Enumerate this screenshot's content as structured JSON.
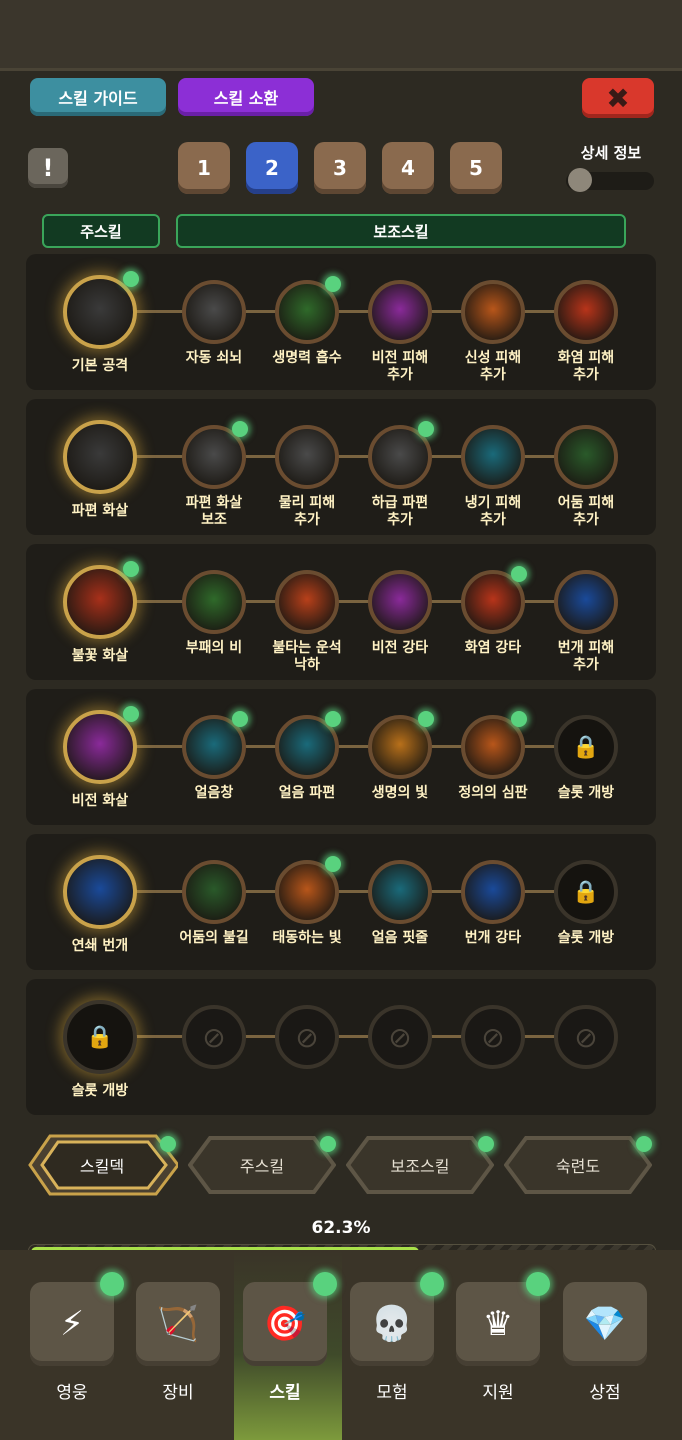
{
  "header": {
    "guide_label": "스킬 가이드",
    "summon_label": "스킬 소환",
    "close_glyph": "✖",
    "info_glyph": "!",
    "presets": [
      "1",
      "2",
      "3",
      "4",
      "5"
    ],
    "active_preset": "2",
    "detail_label": "상세 정보",
    "detail_toggle_on": false
  },
  "sections": {
    "main_label": "주스킬",
    "sub_label": "보조스킬"
  },
  "rows": [
    {
      "main": {
        "label": "기본 공격",
        "icon": "arrow-icon",
        "color": "#3a3a3a",
        "badge": true
      },
      "subs": [
        {
          "label": "자동 쇠뇌",
          "icon": "crossbow-icon",
          "color": "#4a4a4a",
          "badge": false
        },
        {
          "label": "생명력 흡수",
          "icon": "heart-icon",
          "color": "#2f6a2a",
          "badge": true
        },
        {
          "label": "비전 피해\n추가",
          "icon": "arcane-icon",
          "color": "#8a2a9a",
          "badge": false
        },
        {
          "label": "신성 피해\n추가",
          "icon": "holy-icon",
          "color": "#b8561a",
          "badge": false
        },
        {
          "label": "화염 피해\n추가",
          "icon": "fire-icon",
          "color": "#b8341a",
          "badge": false
        }
      ]
    },
    {
      "main": {
        "label": "파편 화살",
        "icon": "shard-arrow-icon",
        "color": "#3a3a3a",
        "badge": false
      },
      "subs": [
        {
          "label": "파편 화살\n보조",
          "icon": "shard-burst-icon",
          "color": "#4a4a4a",
          "badge": true
        },
        {
          "label": "물리 피해\n추가",
          "icon": "physical-icon",
          "color": "#4a4a4a",
          "badge": false
        },
        {
          "label": "하급 파편\n추가",
          "icon": "minor-shard-icon",
          "color": "#4a4a4a",
          "badge": true
        },
        {
          "label": "냉기 피해\n추가",
          "icon": "frost-icon",
          "color": "#1a6a7a",
          "badge": false
        },
        {
          "label": "어둠 피해\n추가",
          "icon": "skull-icon",
          "color": "#2a5a2a",
          "badge": false
        }
      ]
    },
    {
      "main": {
        "label": "불꽃 화살",
        "icon": "flame-arrow-icon",
        "color": "#a8301a",
        "badge": true
      },
      "subs": [
        {
          "label": "부패의 비",
          "icon": "decay-icon",
          "color": "#2f6a2a",
          "badge": false
        },
        {
          "label": "불타는 운석\n낙하",
          "icon": "meteor-icon",
          "color": "#b8401a",
          "badge": false
        },
        {
          "label": "비전 강타",
          "icon": "arcane-strike-icon",
          "color": "#8a2a9a",
          "badge": false
        },
        {
          "label": "화염 강타",
          "icon": "fire-strike-icon",
          "color": "#b8341a",
          "badge": true
        },
        {
          "label": "번개 피해\n추가",
          "icon": "lightning-icon",
          "color": "#1a4a9a",
          "badge": false
        }
      ]
    },
    {
      "main": {
        "label": "비전 화살",
        "icon": "arcane-arrow-icon",
        "color": "#8a2a9a",
        "badge": true
      },
      "subs": [
        {
          "label": "얼음창",
          "icon": "ice-spear-icon",
          "color": "#1a6a7a",
          "badge": true
        },
        {
          "label": "얼음 파편",
          "icon": "ice-shard-icon",
          "color": "#1a6a7a",
          "badge": true
        },
        {
          "label": "생명의 빛",
          "icon": "life-light-icon",
          "color": "#b8701a",
          "badge": true
        },
        {
          "label": "정의의 심판",
          "icon": "judgement-icon",
          "color": "#b8561a",
          "badge": true
        },
        {
          "label": "슬롯 개방",
          "icon": "lock-icon",
          "color": "#15130f",
          "badge": false,
          "locked": true
        }
      ]
    },
    {
      "main": {
        "label": "연쇄 번개",
        "icon": "chain-lightning-icon",
        "color": "#1a4a9a",
        "badge": false
      },
      "subs": [
        {
          "label": "어둠의 불길",
          "icon": "dark-flame-icon",
          "color": "#2a5a2a",
          "badge": false
        },
        {
          "label": "태동하는 빛",
          "icon": "pulse-light-icon",
          "color": "#b8561a",
          "badge": true
        },
        {
          "label": "얼음 핏줄",
          "icon": "ice-vein-icon",
          "color": "#1a6a7a",
          "badge": false
        },
        {
          "label": "번개 강타",
          "icon": "lightning-strike-icon",
          "color": "#1a4a9a",
          "badge": false
        },
        {
          "label": "슬롯 개방",
          "icon": "lock-icon",
          "color": "#15130f",
          "badge": false,
          "locked": true
        }
      ]
    },
    {
      "main": {
        "label": "슬롯 개방",
        "icon": "lock-icon",
        "color": "#15130f",
        "badge": false,
        "locked": true
      },
      "subs": [
        {
          "label": "",
          "icon": "blocked-icon",
          "empty": true
        },
        {
          "label": "",
          "icon": "blocked-icon",
          "empty": true
        },
        {
          "label": "",
          "icon": "blocked-icon",
          "empty": true
        },
        {
          "label": "",
          "icon": "blocked-icon",
          "empty": true
        },
        {
          "label": "",
          "icon": "blocked-icon",
          "empty": true
        }
      ]
    }
  ],
  "tabs": [
    {
      "label": "스킬덱",
      "active": true,
      "badge": true
    },
    {
      "label": "주스킬",
      "active": false,
      "badge": true
    },
    {
      "label": "보조스킬",
      "active": false,
      "badge": true
    },
    {
      "label": "숙련도",
      "active": false,
      "badge": true
    }
  ],
  "progress": {
    "text": "62.3%",
    "value": 0.623
  },
  "nav": [
    {
      "label": "영웅",
      "icon": "lightning-icon",
      "glyph": "⚡",
      "badge": true
    },
    {
      "label": "장비",
      "icon": "bow-icon",
      "glyph": "🏹",
      "badge": false
    },
    {
      "label": "스킬",
      "icon": "target-icon",
      "glyph": "🎯",
      "badge": true,
      "active": true
    },
    {
      "label": "모험",
      "icon": "skull-icon",
      "glyph": "💀",
      "badge": true
    },
    {
      "label": "지원",
      "icon": "banner-icon",
      "glyph": "♛",
      "badge": true
    },
    {
      "label": "상점",
      "icon": "chest-icon",
      "glyph": "💎",
      "badge": false
    }
  ]
}
